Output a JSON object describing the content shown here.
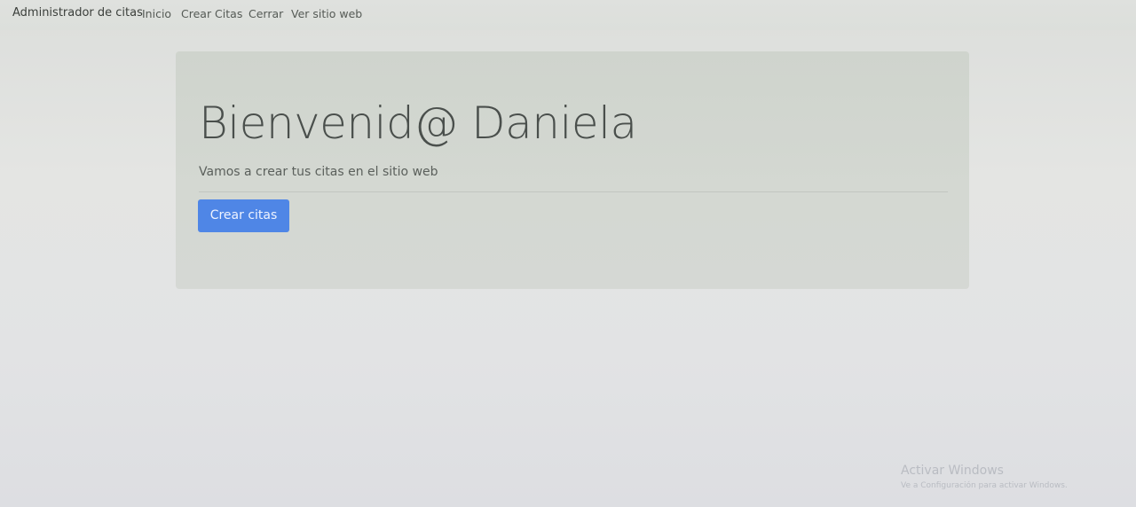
{
  "navbar": {
    "brand": "Administrador de citas",
    "links": [
      {
        "label": "Inicio"
      },
      {
        "label": "Crear Citas"
      },
      {
        "label": "Cerrar"
      },
      {
        "label": "Ver sitio web"
      }
    ]
  },
  "jumbotron": {
    "title": "Bienvenid@ Daniela",
    "lead": "Vamos a crear tus citas en el sitio web",
    "button_label": "Crear citas"
  },
  "watermark": {
    "title": "Activar Windows",
    "subtitle": "Ve a Configuración para activar Windows."
  },
  "colors": {
    "primary_button": "#4f86e6",
    "jumbotron_bg": "#d2d6d0"
  }
}
